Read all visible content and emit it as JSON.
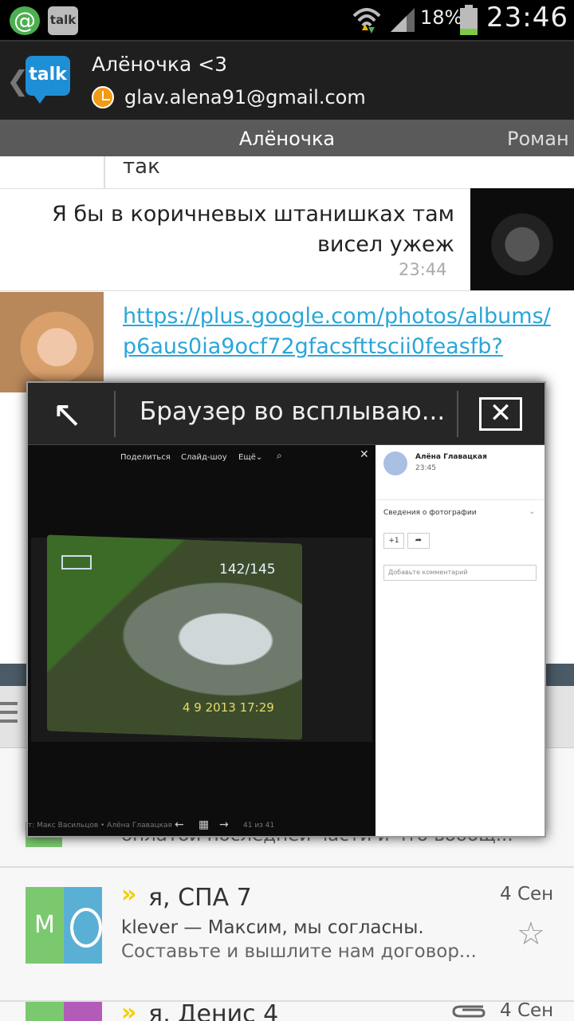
{
  "statusbar": {
    "app_icon_1": "@",
    "app_icon_2": "talk",
    "battery_percent": "18%",
    "time": "23:46"
  },
  "talk": {
    "back_glyph": "❮",
    "logo_text": "talk",
    "contact_name": "Алёночка <3",
    "contact_email": "glav.alena91@gmail.com",
    "tab_active": "Алёночка",
    "tab_next": "Роман"
  },
  "chat": {
    "msg_cut": "так",
    "msg2_text": "Я бы в коричневых штанишках там висел ужеж",
    "msg2_time": "23:44",
    "msg3_link": "https://plus.google.com/photos/albums/p6aus0ia9ocf72gfacsfttscii0feasfb?"
  },
  "mail": {
    "row1_preview": "оплатой последней части и что вообщ...",
    "row2_tile_letter": "M",
    "row2_chev": "»",
    "row2_from": "я, СПА 7",
    "row2_date": "4 Сен",
    "row2_line1": "klever — Максим, мы согласны.",
    "row2_line2": "Составьте и вышлите нам договор...",
    "star_icon": "☆",
    "row3_chev": "»",
    "row3_from": "я, Денис 4",
    "row3_date": "4 Сен"
  },
  "popup": {
    "expand_glyph": "↖",
    "title": "Браузер во всплываю...",
    "close_glyph": "✕",
    "viewer": {
      "share": "Поделиться",
      "slideshow": "Слайд-шоу",
      "more": "Ещё⌄",
      "search_glyph": "⌕",
      "close_glyph": "✕",
      "photo_counter": "142/145",
      "photo_stamp": "4  9 2013 17:29",
      "credit": "т: Макс Васильцов • Алёна Главацкая",
      "prev_glyph": "←",
      "grid_glyph": "▦",
      "next_glyph": "→",
      "count": "41 из 41"
    },
    "side": {
      "name": "Алёна Главацкая",
      "time": "23:45",
      "info": "Сведения о фотографии",
      "info_chev": "⌄",
      "plus_one": "+1",
      "share_glyph": "➦",
      "comment_placeholder": "Добавьте комментарий"
    }
  }
}
